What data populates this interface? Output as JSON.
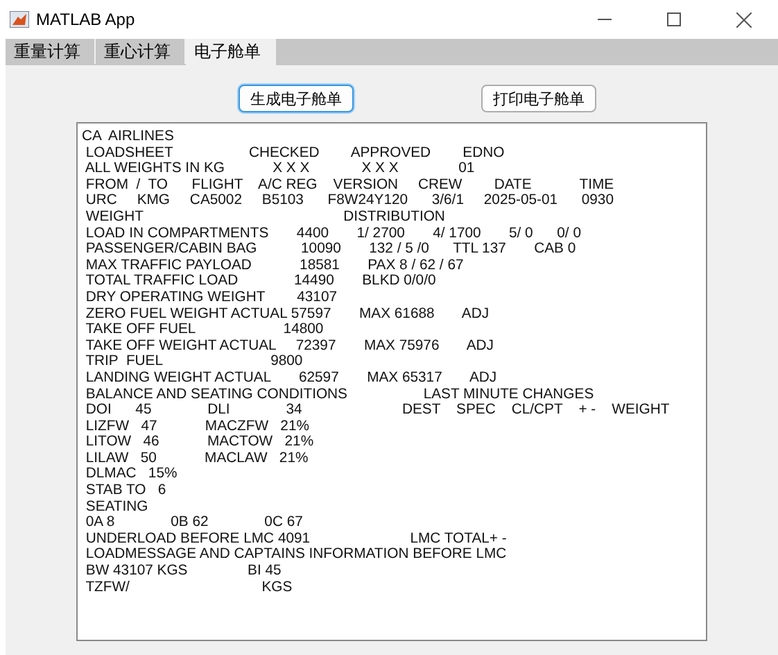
{
  "window": {
    "title": "MATLAB App"
  },
  "tabs": [
    {
      "label": "重量计算",
      "selected": false
    },
    {
      "label": "重心计算",
      "selected": false
    },
    {
      "label": "电子舱单",
      "selected": true
    }
  ],
  "buttons": [
    {
      "label": "生成电子舱单",
      "focused": true
    },
    {
      "label": "打印电子舱单",
      "focused": false
    }
  ],
  "loadsheet_lines": [
    "CA  AIRLINES",
    " LOADSHEET                   CHECKED        APPROVED        EDNO",
    " ALL WEIGHTS IN KG            X X X             X X X               01",
    " FROM  /  TO      FLIGHT    A/C REG    VERSION     CREW        DATE            TIME",
    " URC     KMG     CA5002     B5103      F8W24Y120      3/6/1     2025-05-01      0930",
    " WEIGHT                                                  DISTRIBUTION",
    " LOAD IN COMPARTMENTS       4400       1/ 2700       4/ 1700       5/ 0      0/ 0",
    " PASSENGER/CABIN BAG           10090       132 / 5 /0      TTL 137       CAB 0",
    " MAX TRAFFIC PAYLOAD            18581       PAX 8 / 62 / 67",
    " TOTAL TRAFFIC LOAD              14490       BLKD 0/0/0",
    " DRY OPERATING WEIGHT        43107",
    " ZERO FUEL WEIGHT ACTUAL 57597       MAX 61688       ADJ",
    " TAKE OFF FUEL                      14800",
    " TAKE OFF WEIGHT ACTUAL     72397       MAX 75976       ADJ",
    " TRIP  FUEL                           9800",
    " LANDING WEIGHT ACTUAL       62597       MAX 65317       ADJ",
    " BALANCE AND SEATING CONDITIONS                   LAST MINUTE CHANGES",
    " DOI      45              DLI              34                         DEST    SPEC    CL/CPT    + -    WEIGHT",
    " LIZFW   47            MACZFW   21%",
    " LITOW   46            MACTOW   21%",
    " LILAW   50            MACLAW   21%",
    " DLMAC   15%",
    " STAB TO   6",
    " SEATING",
    " 0A 8              0B 62              0C 67",
    " UNDERLOAD BEFORE LMC 4091                         LMC TOTAL+ -",
    " LOADMESSAGE AND CAPTAINS INFORMATION BEFORE LMC",
    " BW 43107 KGS               BI 45",
    " TZFW/                                 KGS"
  ]
}
